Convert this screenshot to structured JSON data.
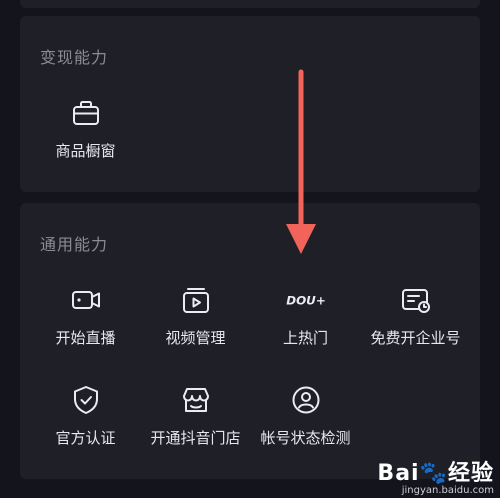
{
  "monetize": {
    "title": "变现能力",
    "items": [
      {
        "label": "商品橱窗",
        "icon": "briefcase-icon"
      }
    ]
  },
  "general": {
    "title": "通用能力",
    "items": [
      {
        "label": "开始直播",
        "icon": "video-camera-icon"
      },
      {
        "label": "视频管理",
        "icon": "video-manage-icon"
      },
      {
        "label": "上热门",
        "icon": "dou-plus-icon",
        "badge_text": "DOU+"
      },
      {
        "label": "免费开企业号",
        "icon": "enterprise-card-icon"
      },
      {
        "label": "官方认证",
        "icon": "shield-check-icon"
      },
      {
        "label": "开通抖音门店",
        "icon": "store-icon"
      },
      {
        "label": "帐号状态检测",
        "icon": "account-check-icon"
      }
    ]
  },
  "annotation": {
    "arrow_color": "#f0645a"
  },
  "watermark": {
    "brand_part1": "Bai",
    "brand_part2": "经验",
    "site": "jingyan.baidu.com"
  }
}
